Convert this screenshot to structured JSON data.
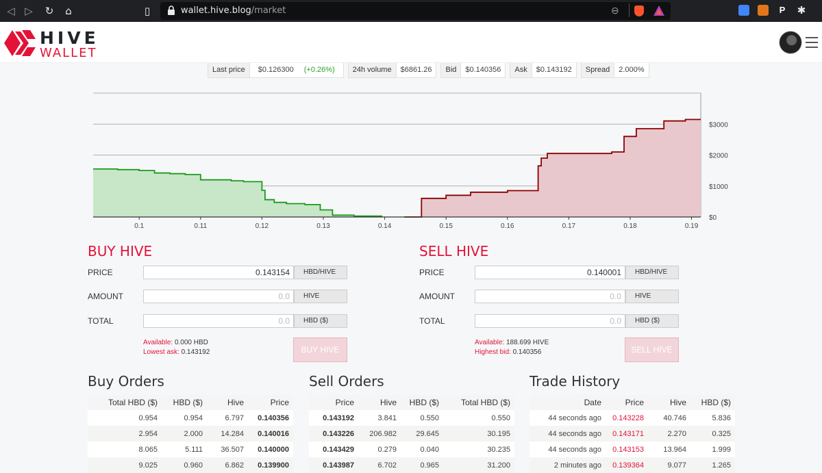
{
  "browser": {
    "url_host": "wallet.hive.blog",
    "url_path": "/market"
  },
  "header": {
    "logo_top": "HIVE",
    "logo_bottom": "WALLET"
  },
  "ticker": [
    {
      "label": "Last price",
      "value": "$0.126300",
      "change": "(+0.26%)"
    },
    {
      "label": "24h volume",
      "value": "$6861.26"
    },
    {
      "label": "Bid",
      "value": "$0.140356"
    },
    {
      "label": "Ask",
      "value": "$0.143192"
    },
    {
      "label": "Spread",
      "value": "2.000%"
    }
  ],
  "chart_data": {
    "type": "area",
    "title": "",
    "xlabel": "",
    "ylabel": "",
    "x_ticks": [
      "0.1",
      "0.11",
      "0.12",
      "0.13",
      "0.14",
      "0.15",
      "0.16",
      "0.17",
      "0.18",
      "0.19"
    ],
    "y_ticks": [
      "$3000",
      "$2000",
      "$1000",
      "$0"
    ],
    "xlim": [
      0.0925,
      0.1915
    ],
    "ylim": [
      0,
      4000
    ],
    "grid": true,
    "colors": {
      "bids": "#1a9b1a",
      "asks": "#8b0000",
      "bids_fill": "#c8e6c8",
      "asks_fill": "#e8c8cc"
    },
    "series": [
      {
        "points": [
          [
            0.0925,
            1550
          ],
          [
            0.0965,
            1550
          ],
          [
            0.0965,
            1530
          ],
          [
            0.1,
            1530
          ],
          [
            0.1,
            1500
          ],
          [
            0.1025,
            1500
          ],
          [
            0.1025,
            1420
          ],
          [
            0.105,
            1420
          ],
          [
            0.105,
            1400
          ],
          [
            0.1075,
            1400
          ],
          [
            0.1075,
            1370
          ],
          [
            0.11,
            1370
          ],
          [
            0.11,
            1200
          ],
          [
            0.115,
            1200
          ],
          [
            0.115,
            1170
          ],
          [
            0.117,
            1170
          ],
          [
            0.117,
            1140
          ],
          [
            0.12,
            1140
          ],
          [
            0.12,
            860
          ],
          [
            0.1205,
            860
          ],
          [
            0.1205,
            560
          ],
          [
            0.122,
            560
          ],
          [
            0.122,
            470
          ],
          [
            0.124,
            470
          ],
          [
            0.124,
            430
          ],
          [
            0.127,
            430
          ],
          [
            0.127,
            400
          ],
          [
            0.1295,
            400
          ],
          [
            0.1295,
            230
          ],
          [
            0.1315,
            230
          ],
          [
            0.1315,
            60
          ],
          [
            0.135,
            60
          ],
          [
            0.135,
            30
          ],
          [
            0.1395,
            30
          ],
          [
            0.1395,
            0
          ]
        ]
      },
      {
        "points": [
          [
            0.1432,
            0
          ],
          [
            0.146,
            0
          ],
          [
            0.146,
            600
          ],
          [
            0.15,
            600
          ],
          [
            0.15,
            700
          ],
          [
            0.154,
            700
          ],
          [
            0.154,
            800
          ],
          [
            0.16,
            800
          ],
          [
            0.16,
            850
          ],
          [
            0.165,
            850
          ],
          [
            0.165,
            1650
          ],
          [
            0.1655,
            1650
          ],
          [
            0.1655,
            1900
          ],
          [
            0.1665,
            1900
          ],
          [
            0.1665,
            2050
          ],
          [
            0.17,
            2050
          ],
          [
            0.17,
            2050
          ],
          [
            0.177,
            2050
          ],
          [
            0.177,
            2100
          ],
          [
            0.179,
            2100
          ],
          [
            0.179,
            2600
          ],
          [
            0.181,
            2600
          ],
          [
            0.181,
            2850
          ],
          [
            0.1855,
            2850
          ],
          [
            0.1855,
            3100
          ],
          [
            0.189,
            3100
          ],
          [
            0.189,
            3150
          ],
          [
            0.1915,
            3150
          ]
        ]
      }
    ]
  },
  "buy_form": {
    "title": "BUY HIVE",
    "price_label": "PRICE",
    "price_value": "0.143154",
    "price_unit": "HBD/HIVE",
    "amount_label": "AMOUNT",
    "amount_placeholder": "0.0",
    "amount_unit": "HIVE",
    "total_label": "TOTAL",
    "total_placeholder": "0.0",
    "total_unit": "HBD ($)",
    "available_label": "Available:",
    "available_value": "0.000 HBD",
    "best_label": "Lowest ask:",
    "best_value": "0.143192",
    "button": "BUY HIVE"
  },
  "sell_form": {
    "title": "SELL HIVE",
    "price_label": "PRICE",
    "price_value": "0.140001",
    "price_unit": "HBD/HIVE",
    "amount_label": "AMOUNT",
    "amount_placeholder": "0.0",
    "amount_unit": "HIVE",
    "total_label": "TOTAL",
    "total_placeholder": "0.0",
    "total_unit": "HBD ($)",
    "available_label": "Available:",
    "available_value": "188.699 HIVE",
    "best_label": "Highest bid:",
    "best_value": "0.140356",
    "button": "SELL HIVE"
  },
  "buy_orders": {
    "title": "Buy Orders",
    "headers": [
      "Total HBD ($)",
      "HBD ($)",
      "Hive",
      "Price"
    ],
    "rows": [
      [
        "0.954",
        "0.954",
        "6.797",
        "0.140356"
      ],
      [
        "2.954",
        "2.000",
        "14.284",
        "0.140016"
      ],
      [
        "8.065",
        "5.111",
        "36.507",
        "0.140000"
      ],
      [
        "9.025",
        "0.960",
        "6.862",
        "0.139900"
      ]
    ]
  },
  "sell_orders": {
    "title": "Sell Orders",
    "headers": [
      "Price",
      "Hive",
      "HBD ($)",
      "Total HBD ($)"
    ],
    "rows": [
      [
        "0.143192",
        "3.841",
        "0.550",
        "0.550"
      ],
      [
        "0.143226",
        "206.982",
        "29.645",
        "30.195"
      ],
      [
        "0.143429",
        "0.279",
        "0.040",
        "30.235"
      ],
      [
        "0.143987",
        "6.702",
        "0.965",
        "31.200"
      ]
    ]
  },
  "trade_history": {
    "title": "Trade History",
    "headers": [
      "Date",
      "Price",
      "Hive",
      "HBD ($)"
    ],
    "rows": [
      [
        "44 seconds ago",
        "0.143228",
        "40.746",
        "5.836"
      ],
      [
        "44 seconds ago",
        "0.143171",
        "2.270",
        "0.325"
      ],
      [
        "44 seconds ago",
        "0.143153",
        "13.964",
        "1.999"
      ],
      [
        "2 minutes ago",
        "0.139364",
        "9.077",
        "1.265"
      ]
    ]
  }
}
